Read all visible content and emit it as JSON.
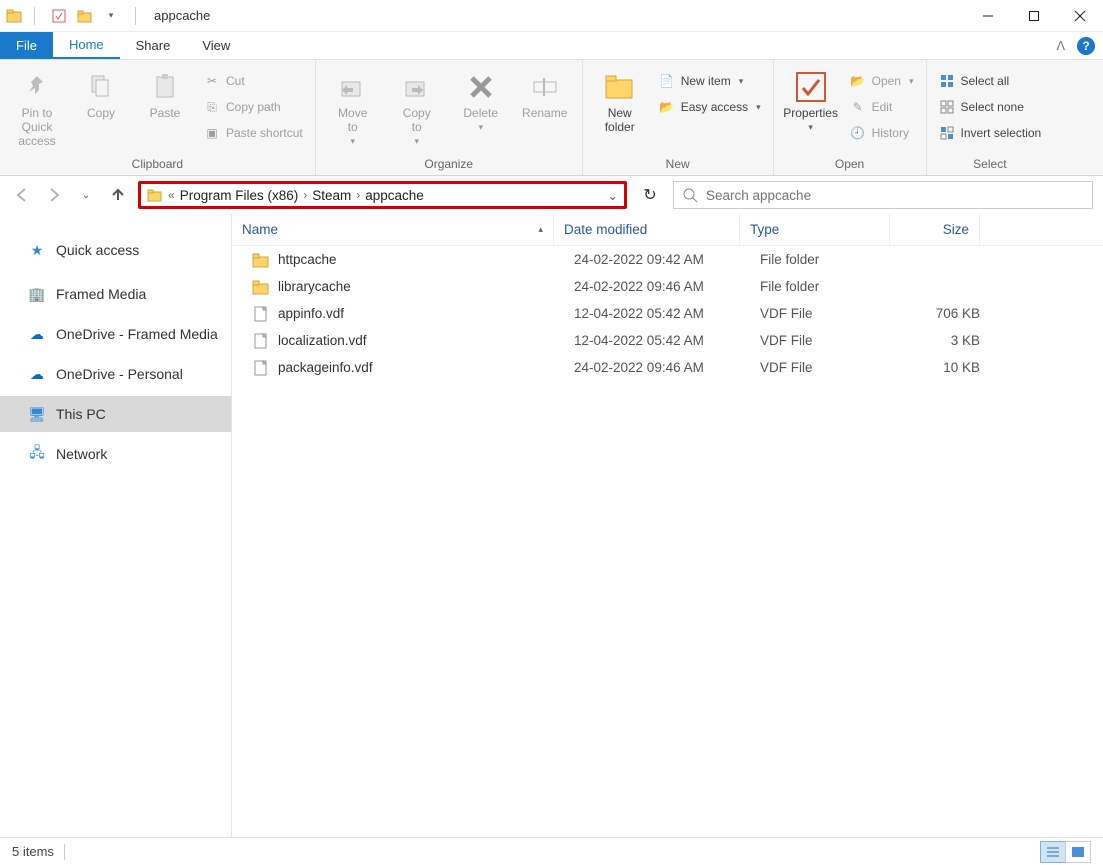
{
  "title": "appcache",
  "tabs": {
    "file": "File",
    "home": "Home",
    "share": "Share",
    "view": "View"
  },
  "ribbon": {
    "clipboard": {
      "label": "Clipboard",
      "pin": "Pin to Quick\naccess",
      "copy": "Copy",
      "paste": "Paste",
      "cut": "Cut",
      "copypath": "Copy path",
      "pasteshortcut": "Paste shortcut"
    },
    "organize": {
      "label": "Organize",
      "moveto": "Move\nto",
      "copyto": "Copy\nto",
      "deletebtn": "Delete",
      "rename": "Rename"
    },
    "new": {
      "label": "New",
      "newfolder": "New\nfolder",
      "newitem": "New item",
      "easyaccess": "Easy access"
    },
    "open": {
      "label": "Open",
      "properties": "Properties",
      "openbtn": "Open",
      "edit": "Edit",
      "history": "History"
    },
    "select": {
      "label": "Select",
      "selectall": "Select all",
      "selectnone": "Select none",
      "invert": "Invert selection"
    }
  },
  "breadcrumbs": [
    "Program Files (x86)",
    "Steam",
    "appcache"
  ],
  "search_placeholder": "Search appcache",
  "nav": {
    "quick": "Quick access",
    "framed": "Framed Media",
    "od_framed": "OneDrive - Framed Media",
    "od_personal": "OneDrive - Personal",
    "thispc": "This PC",
    "network": "Network"
  },
  "columns": {
    "name": "Name",
    "date": "Date modified",
    "type": "Type",
    "size": "Size"
  },
  "files": [
    {
      "name": "httpcache",
      "date": "24-02-2022 09:42 AM",
      "type": "File folder",
      "size": "",
      "icon": "folder"
    },
    {
      "name": "librarycache",
      "date": "24-02-2022 09:46 AM",
      "type": "File folder",
      "size": "",
      "icon": "folder"
    },
    {
      "name": "appinfo.vdf",
      "date": "12-04-2022 05:42 AM",
      "type": "VDF File",
      "size": "706 KB",
      "icon": "file"
    },
    {
      "name": "localization.vdf",
      "date": "12-04-2022 05:42 AM",
      "type": "VDF File",
      "size": "3 KB",
      "icon": "file"
    },
    {
      "name": "packageinfo.vdf",
      "date": "24-02-2022 09:46 AM",
      "type": "VDF File",
      "size": "10 KB",
      "icon": "file"
    }
  ],
  "status": "5 items"
}
